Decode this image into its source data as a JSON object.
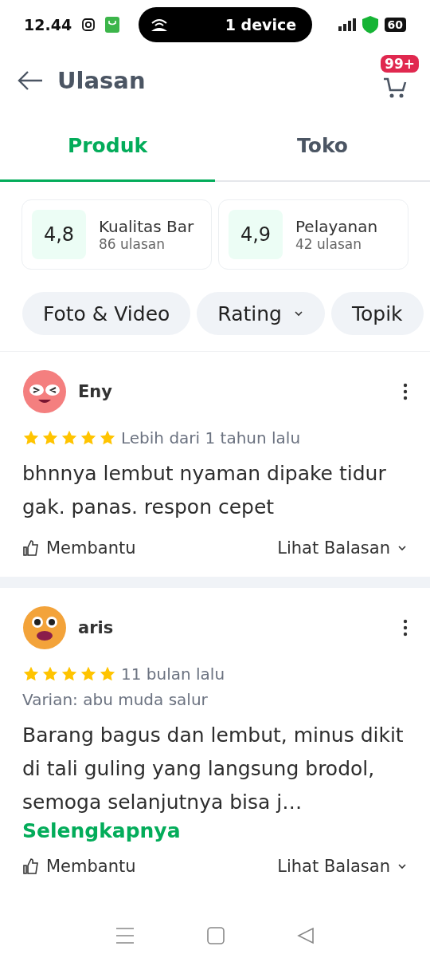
{
  "status_bar": {
    "time": "12.44",
    "hotspot": "1 device",
    "battery": "60"
  },
  "header": {
    "title": "Ulasan",
    "cart_badge": "99+"
  },
  "tabs": [
    {
      "label": "Produk",
      "selected": true
    },
    {
      "label": "Toko",
      "selected": false
    }
  ],
  "rating_cards": [
    {
      "score": "4,8",
      "label": "Kualitas Bar",
      "count": "86 ulasan"
    },
    {
      "score": "4,9",
      "label": "Pelayanan",
      "count": "42 ulasan"
    }
  ],
  "filters": [
    {
      "label": "Foto & Video",
      "kind": "toggle"
    },
    {
      "label": "Rating",
      "kind": "dropdown"
    },
    {
      "label": "Topik",
      "kind": "toggle"
    }
  ],
  "reviews": [
    {
      "name": "Eny",
      "color": "#f47f7f",
      "stars": 5,
      "time": "Lebih dari 1 tahun lalu",
      "text": "bhnnya lembut nyaman dipake tidur gak. panas. respon cepet",
      "helpful": "Membantu",
      "replies": "Lihat Balasan"
    },
    {
      "name": "aris",
      "color": "#f3a33a",
      "stars": 5,
      "time": "11 bulan lalu",
      "variant": "Varian: abu muda salur",
      "text": "Barang bagus dan lembut, minus dikit di tali guling yang langsung brodol, semoga selanjutnya bisa j…",
      "more": "Selengkapnya",
      "helpful": "Membantu",
      "replies": "Lihat Balasan"
    }
  ]
}
